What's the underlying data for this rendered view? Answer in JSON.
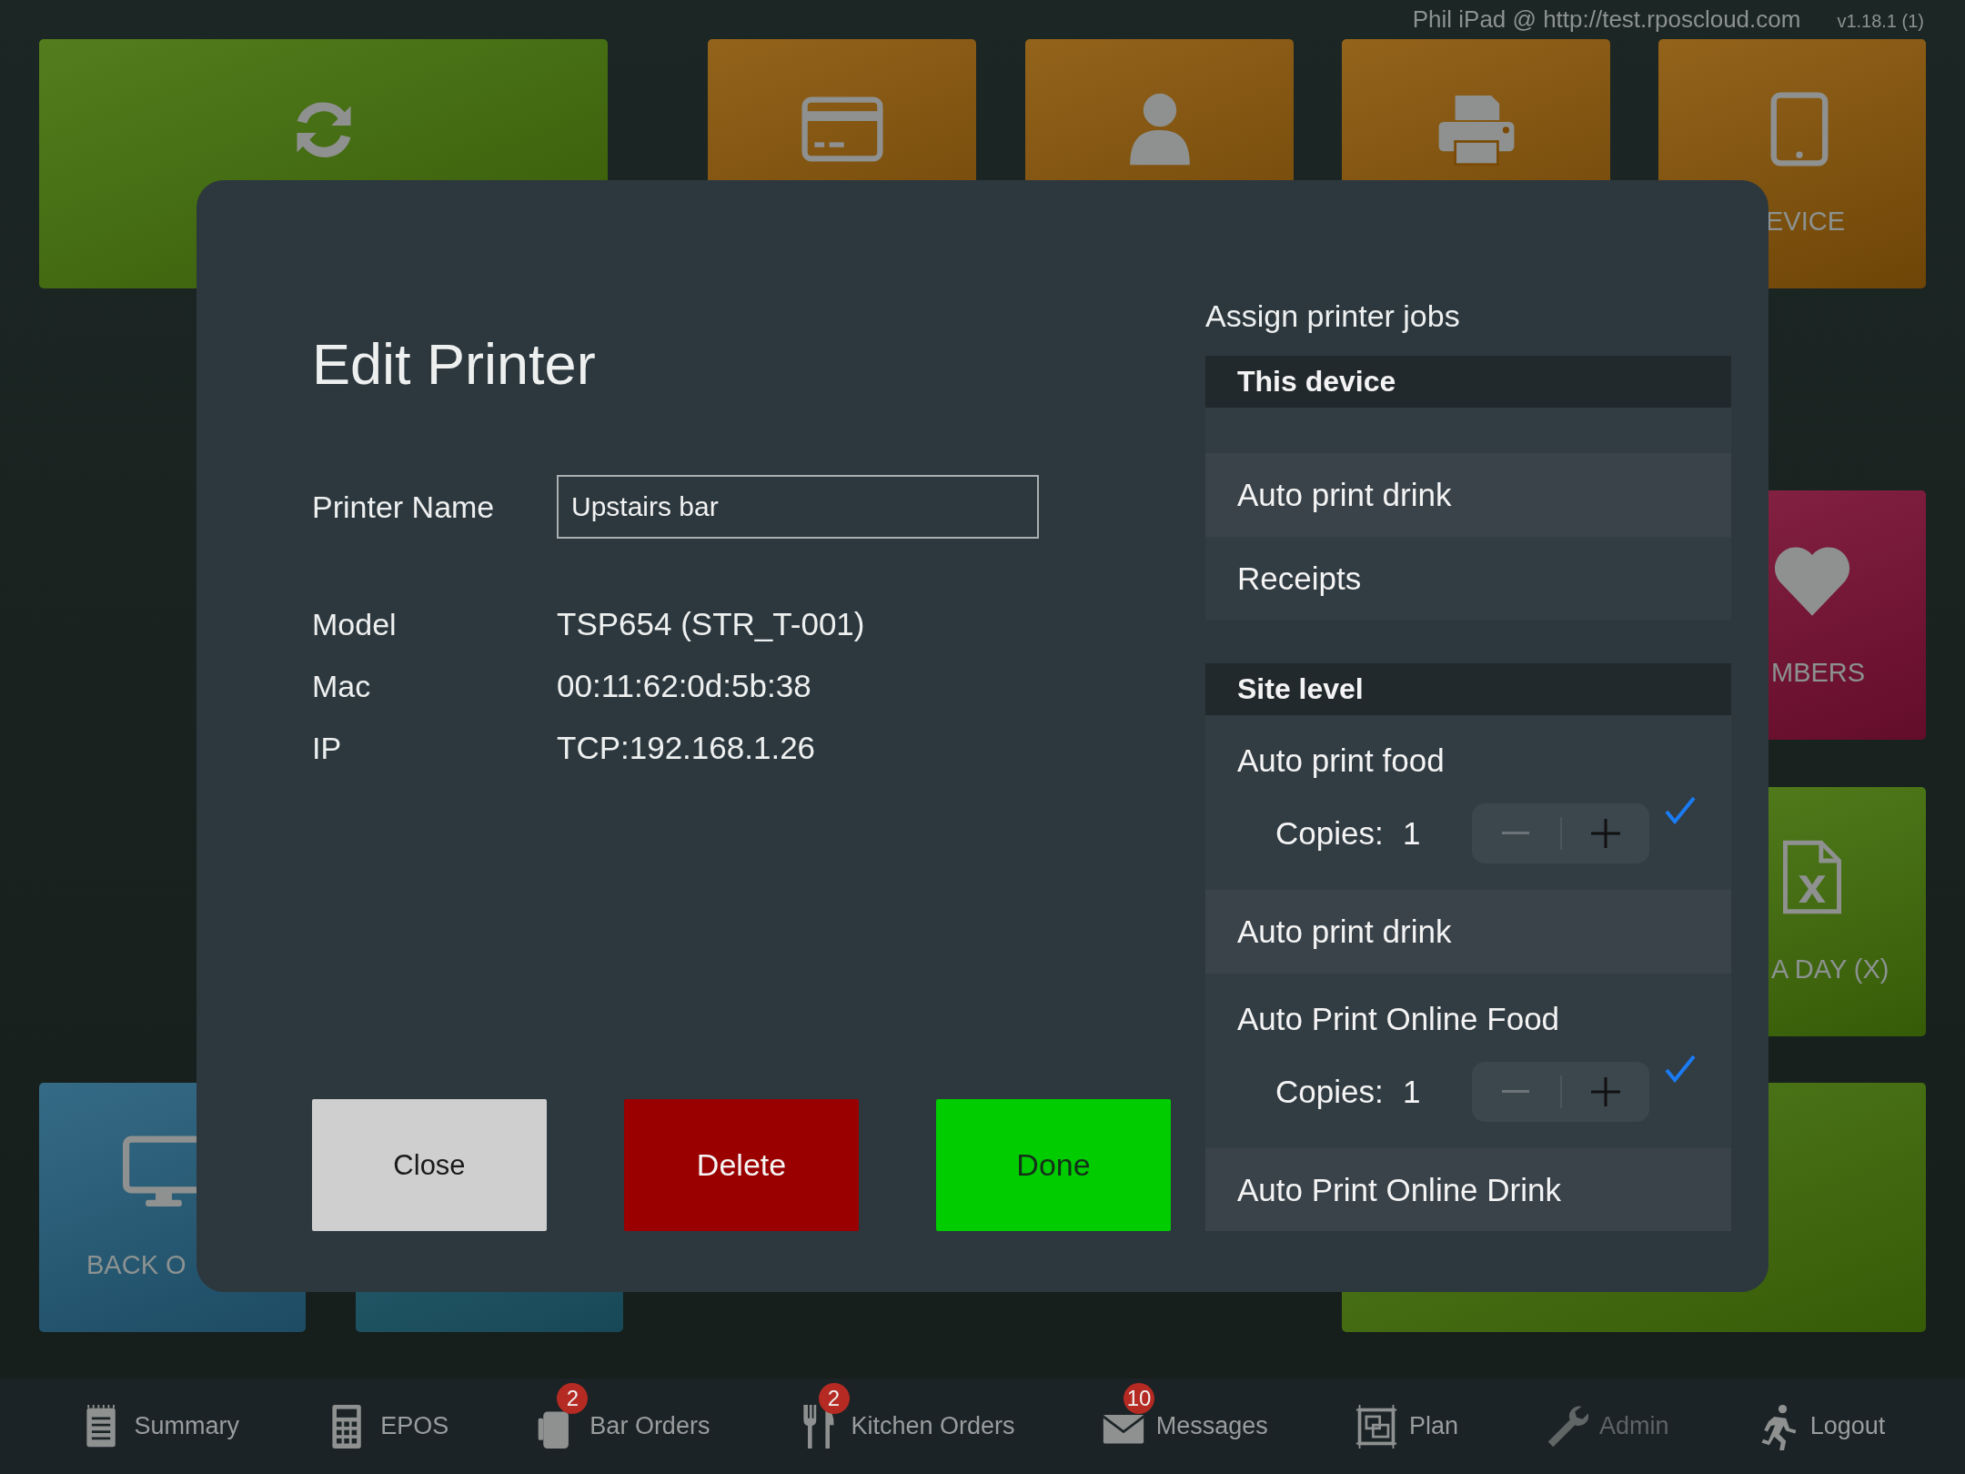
{
  "header": {
    "device": "Phil iPad @ http://test.rposcloud.com",
    "version": "v1.18.1 (1)"
  },
  "tiles": [
    {
      "color": "#44720a"
    },
    {
      "color": "#8a5608"
    },
    {
      "color": "#8a5608"
    },
    {
      "color": "#8a5608"
    },
    {
      "color": "#8a5608",
      "label": "EVICE"
    },
    {
      "color": "#7c1034",
      "label": "MBERS"
    },
    {
      "color": "#44720a",
      "label": "A DAY (X)"
    },
    {
      "color": "#245e7c",
      "label": "BACK O"
    },
    {
      "color": "#1d5a6c"
    },
    {
      "color": "#44720a"
    }
  ],
  "dialog": {
    "title": "Edit Printer",
    "name_field": {
      "label": "Printer Name",
      "value": "Upstairs bar"
    },
    "details": [
      {
        "label": "Model",
        "value": "TSP654 (STR_T-001)"
      },
      {
        "label": "Mac",
        "value": "00:11:62:0d:5b:38"
      },
      {
        "label": "IP",
        "value": "TCP:192.168.1.26"
      }
    ],
    "buttons": [
      {
        "label": "Close",
        "kind": "neutral"
      },
      {
        "label": "Delete",
        "kind": "danger"
      },
      {
        "label": "Done",
        "kind": "confirm"
      }
    ]
  },
  "jobs": {
    "title": "Assign printer jobs",
    "sections": [
      {
        "heading": "This device",
        "items": [
          {
            "label": "Auto print drink",
            "checked": false
          },
          {
            "label": "Receipts",
            "checked": false
          }
        ]
      },
      {
        "heading": "Site level",
        "items": [
          {
            "label": "Auto print food",
            "checked": true,
            "copies_label": "Copies:",
            "copies": "1"
          },
          {
            "label": "Auto print drink",
            "checked": false
          },
          {
            "label": "Auto Print Online Food",
            "checked": true,
            "copies_label": "Copies:",
            "copies": "1"
          },
          {
            "label": "Auto Print Online Drink",
            "checked": false
          }
        ]
      }
    ]
  },
  "nav": {
    "items": [
      {
        "label": "Summary",
        "disabled": false
      },
      {
        "label": "EPOS",
        "disabled": false
      },
      {
        "label": "Bar Orders",
        "badge": "2",
        "disabled": false
      },
      {
        "label": "Kitchen Orders",
        "badge": "2",
        "disabled": false
      },
      {
        "label": "Messages",
        "badge": "10",
        "disabled": false
      },
      {
        "label": "Plan",
        "disabled": false
      },
      {
        "label": "Admin",
        "disabled": true
      },
      {
        "label": "Logout",
        "disabled": false
      }
    ]
  }
}
